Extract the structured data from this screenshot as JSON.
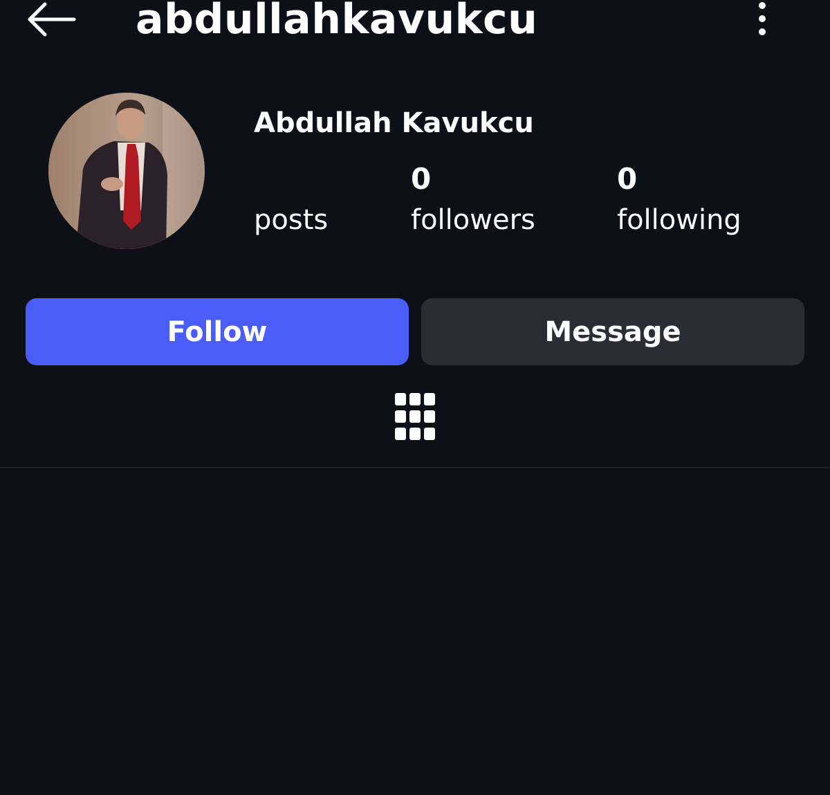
{
  "header": {
    "username": "abdullahkavukcu",
    "back_icon": "arrow-left-icon",
    "more_icon": "more-vertical-icon"
  },
  "profile": {
    "display_name": "Abdullah Kavukcu",
    "stats": {
      "posts_count": "",
      "posts_label": "posts",
      "followers_count": "0",
      "followers_label": "followers",
      "following_count": "0",
      "following_label": "following"
    }
  },
  "actions": {
    "follow_label": "Follow",
    "message_label": "Message"
  },
  "tabs": {
    "grid_icon": "grid-icon"
  },
  "colors": {
    "background": "#0d1016",
    "follow_button": "#4a5df9",
    "message_button": "#2a2d33",
    "text": "#ffffff"
  }
}
